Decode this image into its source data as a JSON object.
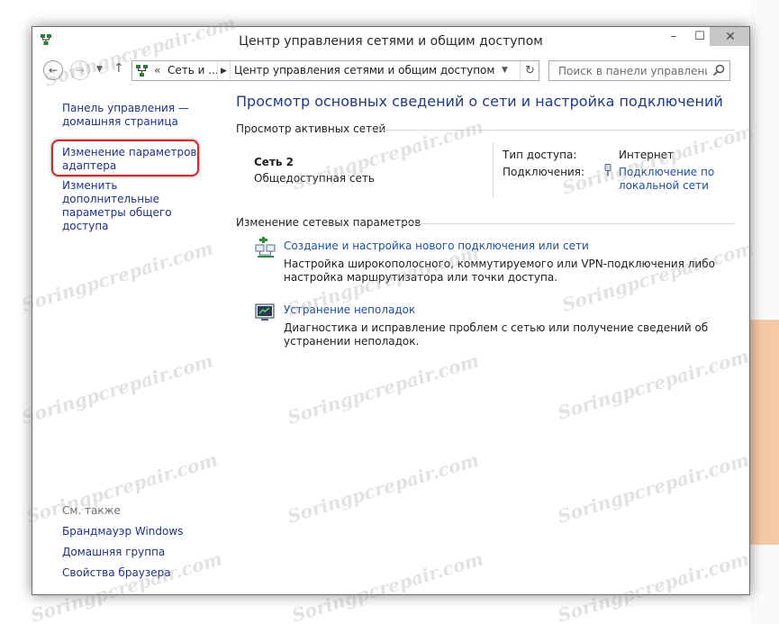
{
  "window": {
    "title": "Центр управления сетями и общим доступом",
    "close_glyph": "✕",
    "minimize_glyph": "–",
    "maximize_glyph": "☐"
  },
  "navbar": {
    "back_glyph": "←",
    "forward_glyph": "→",
    "history_glyph": "▼",
    "up_glyph": "↑",
    "address": {
      "overflow_glyph": "«",
      "segment_1": "Сеть и ...",
      "separator_glyph": "▶",
      "segment_2": "Центр управления сетями и общим доступом",
      "dropdown_glyph": "▼",
      "refresh_glyph": "↻"
    },
    "search": {
      "placeholder": "Поиск в панели управления"
    }
  },
  "sidebar": {
    "home_link": "Панель управления — домашняя страница",
    "adapter_link": "Изменение параметров адаптера",
    "sharing_link": "Изменить дополнительные параметры общего доступа",
    "see_also_title": "См. также",
    "see_also": {
      "firewall": "Брандмауэр Windows",
      "homegroup": "Домашняя группа",
      "browser": "Свойства браузера"
    }
  },
  "main": {
    "title": "Просмотр основных сведений о сети и настройка подключений",
    "active_networks": {
      "header": "Просмотр активных сетей",
      "network_name": "Сеть  2",
      "network_type": "Общедоступная сеть",
      "access_label": "Тип доступа:",
      "access_value": "Интернет",
      "connections_label": "Подключения:",
      "connection_link": "Подключение по локальной сети"
    },
    "change_settings": {
      "header": "Изменение сетевых параметров",
      "tasks": [
        {
          "link": "Создание и настройка нового подключения или сети",
          "description": "Настройка широкополосного, коммутируемого или VPN-подключения либо настройка маршрутизатора или точки доступа."
        },
        {
          "link": "Устранение неполадок",
          "description": "Диагностика и исправление проблем с сетью или получение сведений об устранении неполадок."
        }
      ]
    }
  },
  "watermark": {
    "text": "Soringpcrepair.com"
  },
  "colors": {
    "link": "#1e3287",
    "task_link": "#1e4fa8",
    "title_blue": "#1e3a8a",
    "highlight": "#d4262b"
  }
}
